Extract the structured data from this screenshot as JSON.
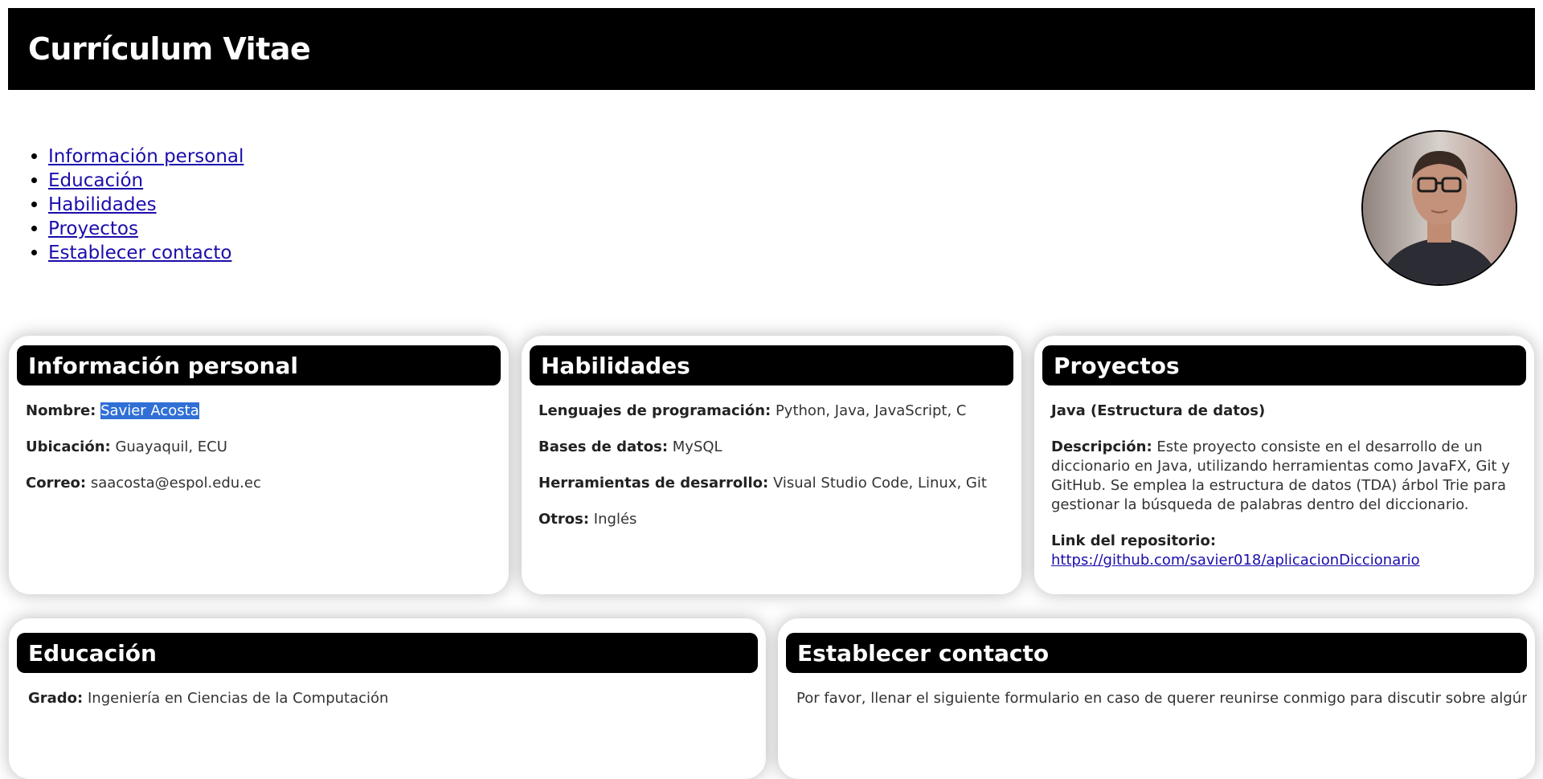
{
  "header": {
    "title": "Currículum Vitae"
  },
  "nav": {
    "items": [
      {
        "label": "Información personal"
      },
      {
        "label": "Educación"
      },
      {
        "label": "Habilidades"
      },
      {
        "label": "Proyectos"
      },
      {
        "label": "Establecer contacto"
      }
    ]
  },
  "personal": {
    "title": "Información personal",
    "name_label": "Nombre:",
    "name_value": "Savier Acosta",
    "location_label": "Ubicación:",
    "location_value": "Guayaquil, ECU",
    "email_label": "Correo:",
    "email_value": "saacosta@espol.edu.ec"
  },
  "skills": {
    "title": "Habilidades",
    "languages_label": "Lenguajes de programación:",
    "languages_value": "Python, Java, JavaScript, C",
    "db_label": "Bases de datos:",
    "db_value": "MySQL",
    "tools_label": "Herramientas de desarrollo:",
    "tools_value": "Visual Studio Code, Linux, Git",
    "others_label": "Otros:",
    "others_value": "Inglés"
  },
  "projects": {
    "title": "Proyectos",
    "project_name": "Java (Estructura de datos)",
    "desc_label": "Descripción:",
    "desc_value": "Este proyecto consiste en el desarrollo de un diccionario en Java, utilizando herramientas como JavaFX, Git y GitHub. Se emplea la estructura de datos (TDA) árbol Trie para gestionar la búsqueda de palabras dentro del diccionario.",
    "repo_label": "Link del repositorio:",
    "repo_link": "https://github.com/savier018/aplicacionDiccionario"
  },
  "education": {
    "title": "Educación",
    "degree_label": "Grado:",
    "degree_value": "Ingeniería en Ciencias de la Computación"
  },
  "contact": {
    "title": "Establecer contacto",
    "intro": "Por favor, llenar el siguiente formulario en caso de querer reunirse conmigo para discutir sobre algún"
  },
  "colors": {
    "header_bg": "#000000",
    "link": "#1a0dab",
    "selection": "#2f6fd6"
  }
}
